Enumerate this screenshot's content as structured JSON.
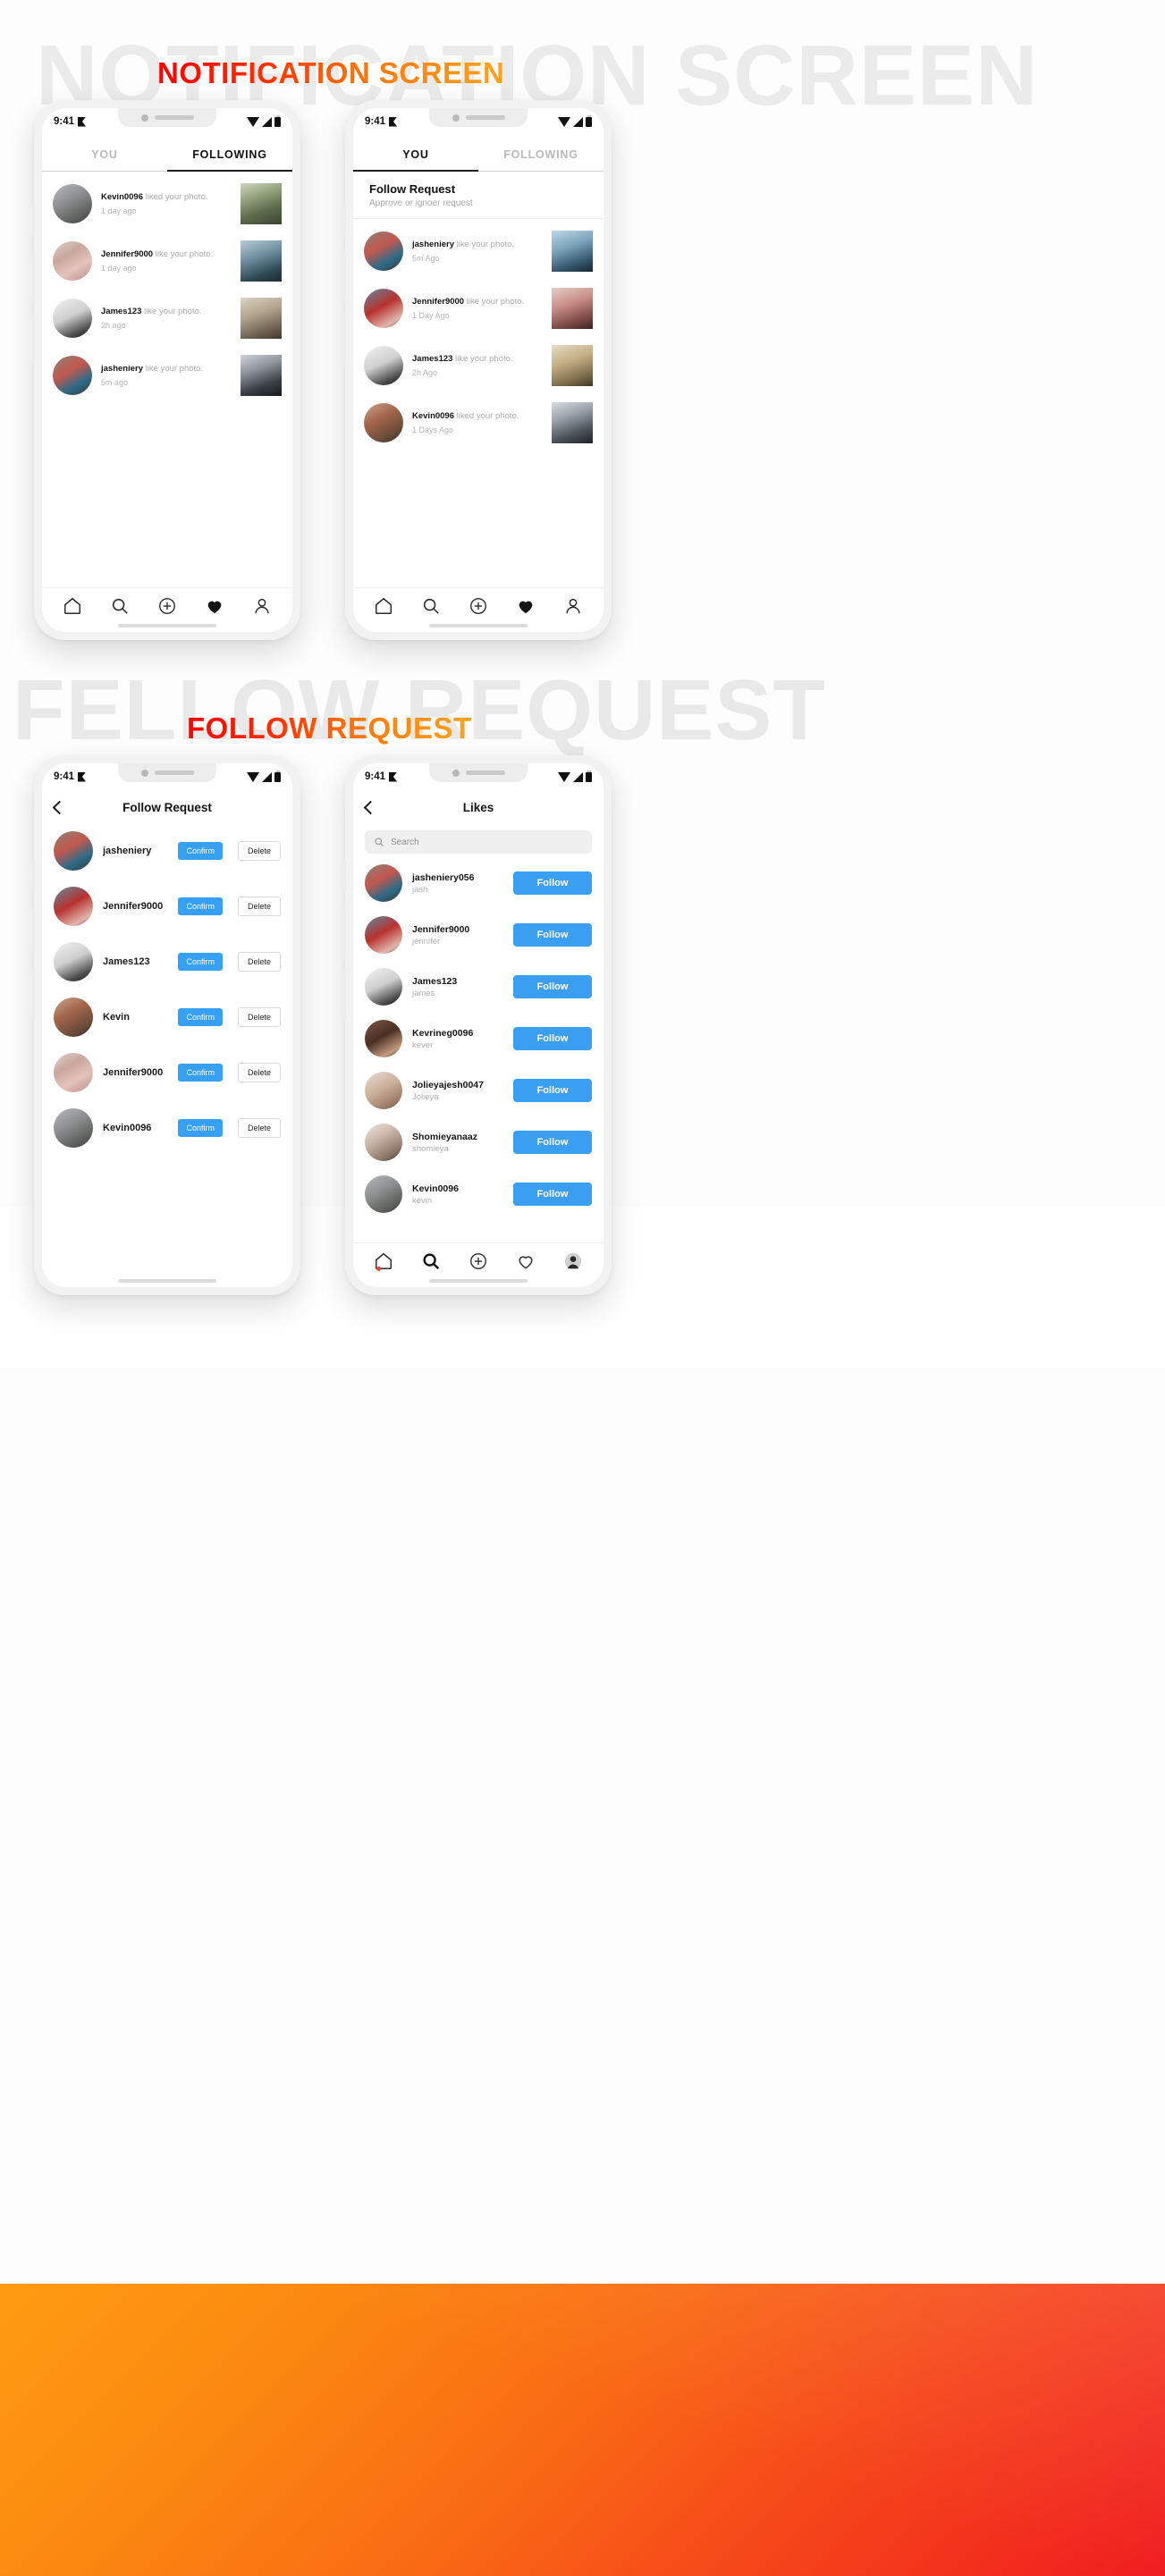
{
  "page": {
    "hero_titles": [
      {
        "id": "notification",
        "text": "NOTIFICATION SCREEN",
        "ghost": "NOTIFICATION SCREEN"
      },
      {
        "id": "follow",
        "text": "FOLLOW REQUEST",
        "ghost": "FELLOW REQUEST"
      }
    ],
    "accent_red": "#ff0000",
    "accent_orange": "#ffa41b",
    "accent_blue": "#3a9ff0"
  },
  "statusbar": {
    "time": "9:41",
    "wifi": "wifi-icon",
    "signal": "signal-icon",
    "battery": "battery-icon"
  },
  "nav": {
    "items": [
      {
        "name": "home",
        "icon": "home-icon"
      },
      {
        "name": "search",
        "icon": "search-icon"
      },
      {
        "name": "add",
        "icon": "plus-circle-icon"
      },
      {
        "name": "activity",
        "icon": "heart-icon"
      },
      {
        "name": "profile",
        "icon": "person-icon"
      }
    ]
  },
  "phone1": {
    "tabs": [
      {
        "label": "YOU",
        "active": false
      },
      {
        "label": "FOLLOWING",
        "active": true
      }
    ],
    "notifications": [
      {
        "user": "Kevin0096",
        "action": "liked your photo.",
        "time": "1 day ago",
        "avatar": "ph-kevin",
        "thumb": "th-couple"
      },
      {
        "user": "Jennifer9000",
        "action": "like your photo.",
        "time": "1 day ago",
        "avatar": "ph-jennifer",
        "thumb": "th-beach"
      },
      {
        "user": "James123",
        "action": "like your photo.",
        "time": "2h ago",
        "avatar": "ph-james",
        "thumb": "th-friends"
      },
      {
        "user": "jasheniery",
        "action": "like your photo.",
        "time": "5m ago",
        "avatar": "ph-jash",
        "thumb": "th-jump"
      }
    ]
  },
  "phone2": {
    "tabs": [
      {
        "label": "YOU",
        "active": true
      },
      {
        "label": "FOLLOWING",
        "active": false
      }
    ],
    "banner": {
      "title": "Follow Request",
      "subtitle": "Approve or ignoer request"
    },
    "notifications": [
      {
        "user": "jasheniery",
        "action": "like your photo.",
        "time": "5m Ago",
        "avatar": "ph-jash",
        "thumb": "th-wheel"
      },
      {
        "user": "Jennifer9000",
        "action": "like your photo.",
        "time": "1 Day Ago",
        "avatar": "ph-jennifer2",
        "thumb": "th-girls"
      },
      {
        "user": "James123",
        "action": "like your photo.",
        "time": "2h Ago",
        "avatar": "ph-james",
        "thumb": "th-field"
      },
      {
        "user": "Kevin0096",
        "action": "liked your photo.",
        "time": "1 Days Ago",
        "avatar": "ph-kevin2",
        "thumb": "th-group"
      }
    ]
  },
  "phone3": {
    "header": {
      "title": "Follow Request",
      "back": "back-chevron-icon"
    },
    "buttons": {
      "confirm": "Confirm",
      "delete": "Delete"
    },
    "requests": [
      {
        "user": "jasheniery",
        "avatar": "ph-jash"
      },
      {
        "user": "Jennifer9000",
        "avatar": "ph-jennifer2"
      },
      {
        "user": "James123",
        "avatar": "ph-james"
      },
      {
        "user": "Kevin",
        "avatar": "ph-kevin2"
      },
      {
        "user": "Jennifer9000",
        "avatar": "ph-jennifer"
      },
      {
        "user": "Kevin0096",
        "avatar": "ph-kevin"
      }
    ]
  },
  "phone4": {
    "header": {
      "title": "Likes",
      "back": "back-chevron-icon"
    },
    "search": {
      "placeholder": "Search",
      "value": ""
    },
    "follow_label": "Follow",
    "users": [
      {
        "name": "jasheniery056",
        "handle": "jash",
        "avatar": "ph-jash"
      },
      {
        "name": "Jennifer9000",
        "handle": "jennifer",
        "avatar": "ph-jennifer2"
      },
      {
        "name": "James123",
        "handle": "james",
        "avatar": "ph-james"
      },
      {
        "name": "Kevrineg0096",
        "handle": "kever",
        "avatar": "ph-kevrin"
      },
      {
        "name": "Jolieyajesh0047",
        "handle": "Jolieya",
        "avatar": "ph-jolie"
      },
      {
        "name": "Shomieyanaaz",
        "handle": "shomieya",
        "avatar": "ph-shom"
      },
      {
        "name": "Kevin0096",
        "handle": "kevin",
        "avatar": "ph-kevin"
      }
    ]
  }
}
